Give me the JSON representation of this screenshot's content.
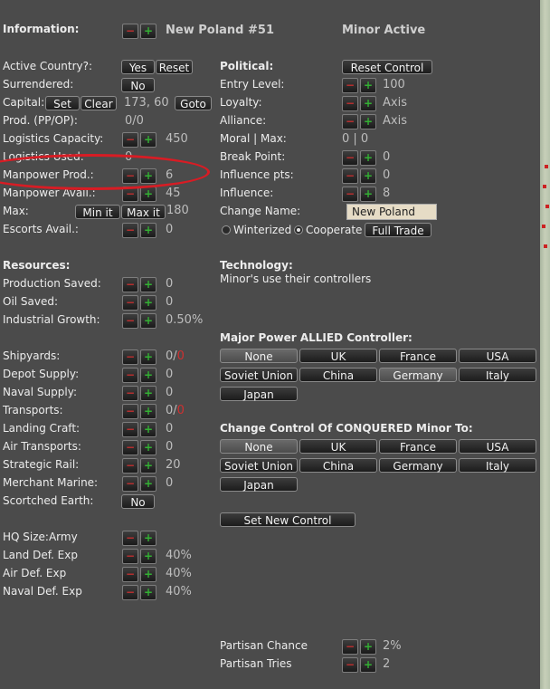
{
  "header": {
    "section": "Information:",
    "country": "New Poland  #51",
    "status": "Minor Active"
  },
  "info": {
    "active_country": "Active Country?:",
    "yes": "Yes",
    "reset": "Reset",
    "surrendered": "Surrendered:",
    "no": "No",
    "capital": "Capital:",
    "set": "Set",
    "clear": "Clear",
    "capital_val": "173, 60",
    "goto": "Goto",
    "prod": "Prod. (PP/OP):",
    "prod_val": "0/0",
    "logistics_capacity": "Logistics Capacity:",
    "logistics_capacity_val": "450",
    "logistics_used": "Logistics Used:",
    "logistics_used_val": "0",
    "manpower_prod": "Manpower Prod.:",
    "manpower_prod_val": "6",
    "manpower_avail": "Manpower Avail.:",
    "manpower_avail_val": "45",
    "max": "Max:",
    "min_it": "Min it",
    "max_it": "Max it",
    "max_val": "180",
    "escorts": "Escorts Avail.:",
    "escorts_val": "0"
  },
  "political": {
    "title": "Political:",
    "reset_control": "Reset Control",
    "entry_level": "Entry Level:",
    "entry_level_val": "100",
    "loyalty": "Loyalty:",
    "loyalty_val": "Axis",
    "alliance": "Alliance:",
    "alliance_val": "Axis",
    "moral": "Moral | Max:",
    "moral_val": "0 | 0",
    "break_point": "Break Point:",
    "break_point_val": "0",
    "influence_pts": "Influence pts:",
    "influence_pts_val": "0",
    "influence": "Influence:",
    "influence_val": "8",
    "change_name": "Change Name:",
    "name_value": "New Poland",
    "winterized": "Winterized",
    "cooperate": "Cooperate",
    "full_trade": "Full Trade"
  },
  "resources": {
    "title": "Resources:",
    "production_saved": "Production Saved:",
    "production_saved_val": "0",
    "oil_saved": "Oil Saved:",
    "oil_saved_val": "0",
    "industrial_growth": "Industrial Growth:",
    "industrial_growth_val": "0.50%"
  },
  "technology": {
    "title": "Technology:",
    "text": "Minor's use their controllers"
  },
  "naval": {
    "shipyards": "Shipyards:",
    "shipyards_val": "0/",
    "shipyards_red": "0",
    "depot_supply": "Depot Supply:",
    "depot_supply_val": "0",
    "naval_supply": "Naval Supply:",
    "naval_supply_val": "0",
    "transports": "Transports:",
    "transports_val": "0/",
    "transports_red": "0",
    "landing_craft": "Landing Craft:",
    "landing_craft_val": "0",
    "air_transports": "Air Transports:",
    "air_transports_val": "0",
    "strategic_rail": "Strategic Rail:",
    "strategic_rail_val": "20",
    "merchant_marine": "Merchant Marine:",
    "merchant_marine_val": "0",
    "scorched_earth": "Scortched Earth:",
    "scorched_no": "No"
  },
  "allied_controller": {
    "title": "Major Power ALLIED Controller:",
    "buttons": [
      "None",
      "UK",
      "France",
      "USA",
      "Soviet Union",
      "China",
      "Germany",
      "Italy",
      "Japan"
    ]
  },
  "conquered_control": {
    "title": "Change Control Of CONQUERED Minor To:",
    "buttons": [
      "None",
      "UK",
      "France",
      "USA",
      "Soviet Union",
      "China",
      "Germany",
      "Italy",
      "Japan"
    ],
    "set_new_control": "Set New Control"
  },
  "hq": {
    "hq_size": "HQ Size:Army",
    "land_def": "Land Def. Exp",
    "land_def_val": "40%",
    "air_def": "Air Def. Exp",
    "air_def_val": "40%",
    "naval_def": "Naval Def. Exp",
    "naval_def_val": "40%"
  },
  "partisan": {
    "chance": "Partisan Chance",
    "chance_val": "2%",
    "tries": "Partisan Tries",
    "tries_val": "2"
  },
  "colors": {
    "highlight": "#d81c24",
    "panel_bg": "#4b4b4b",
    "accent_red": "#c03030",
    "accent_green": "#33b033"
  },
  "icons": {
    "minus": "minus-icon",
    "plus": "plus-icon"
  }
}
